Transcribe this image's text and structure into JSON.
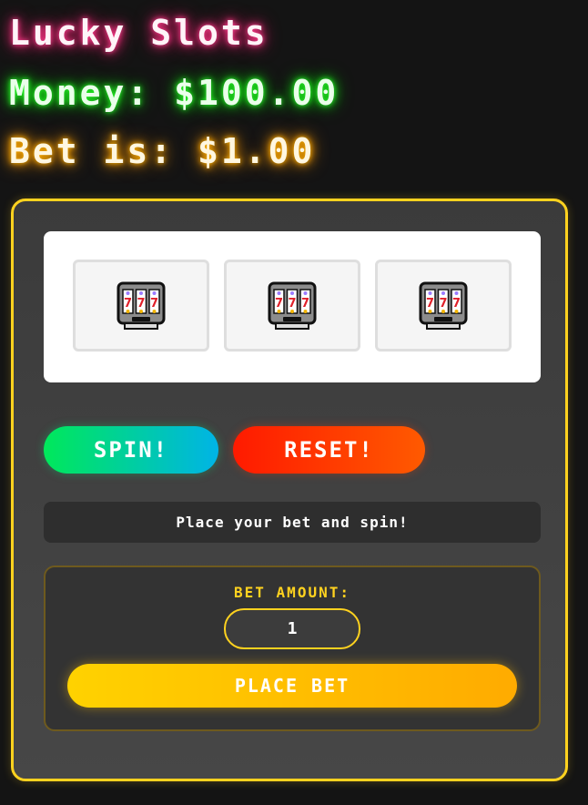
{
  "header": {
    "title": "Lucky Slots",
    "money": "Money: $100.00",
    "bet": "Bet is: $1.00"
  },
  "reels": [
    {
      "symbol": "slot-machine-icon"
    },
    {
      "symbol": "slot-machine-icon"
    },
    {
      "symbol": "slot-machine-icon"
    }
  ],
  "controls": {
    "spin_label": "SPIN!",
    "reset_label": "RESET!"
  },
  "status": {
    "message": "Place your bet and spin!"
  },
  "bet_panel": {
    "label": "BET AMOUNT:",
    "value": "1",
    "button_label": "PLACE BET"
  },
  "colors": {
    "accent": "#ffd21f",
    "title_glow": "#ff3d8f",
    "money_glow": "#2aff2a",
    "bet_glow": "#ffb300"
  }
}
